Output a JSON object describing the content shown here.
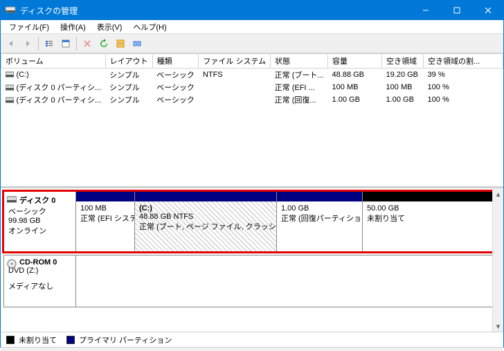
{
  "window": {
    "title": "ディスクの管理"
  },
  "menu": {
    "file": "ファイル(F)",
    "action": "操作(A)",
    "view": "表示(V)",
    "help": "ヘルプ(H)"
  },
  "columns": {
    "volume": "ボリューム",
    "layout": "レイアウト",
    "type": "種類",
    "filesystem": "ファイル システム",
    "status": "状態",
    "capacity": "容量",
    "free": "空き領域",
    "freepct": "空き領域の割..."
  },
  "volumes": [
    {
      "name": "(C:)",
      "layout": "シンプル",
      "type": "ベーシック",
      "fs": "NTFS",
      "status": "正常 (ブート...",
      "cap": "48.88 GB",
      "free": "19.20 GB",
      "pct": "39 %"
    },
    {
      "name": "(ディスク 0 パーティシ...",
      "layout": "シンプル",
      "type": "ベーシック",
      "fs": "",
      "status": "正常 (EFI ...",
      "cap": "100 MB",
      "free": "100 MB",
      "pct": "100 %"
    },
    {
      "name": "(ディスク 0 パーティシ...",
      "layout": "シンプル",
      "type": "ベーシック",
      "fs": "",
      "status": "正常 (回復...",
      "cap": "1.00 GB",
      "free": "1.00 GB",
      "pct": "100 %"
    }
  ],
  "disk0": {
    "name": "ディスク 0",
    "type": "ベーシック",
    "size": "99.98 GB",
    "state": "オンライン",
    "p1": {
      "size": "100 MB",
      "status": "正常 (EFI システム"
    },
    "p2": {
      "label": "(C:)",
      "size": "48.88 GB NTFS",
      "status": "正常 (ブート, ページ ファイル, クラッシュ ダンプ, ベ"
    },
    "p3": {
      "size": "1.00 GB",
      "status": "正常 (回復パーティション)"
    },
    "p4": {
      "size": "50.00 GB",
      "status": "未割り当て"
    }
  },
  "cdrom": {
    "name": "CD-ROM 0",
    "drive": "DVD (Z:)",
    "state": "メディアなし"
  },
  "legend": {
    "unalloc": "未割り当て",
    "primary": "プライマリ パーティション"
  }
}
